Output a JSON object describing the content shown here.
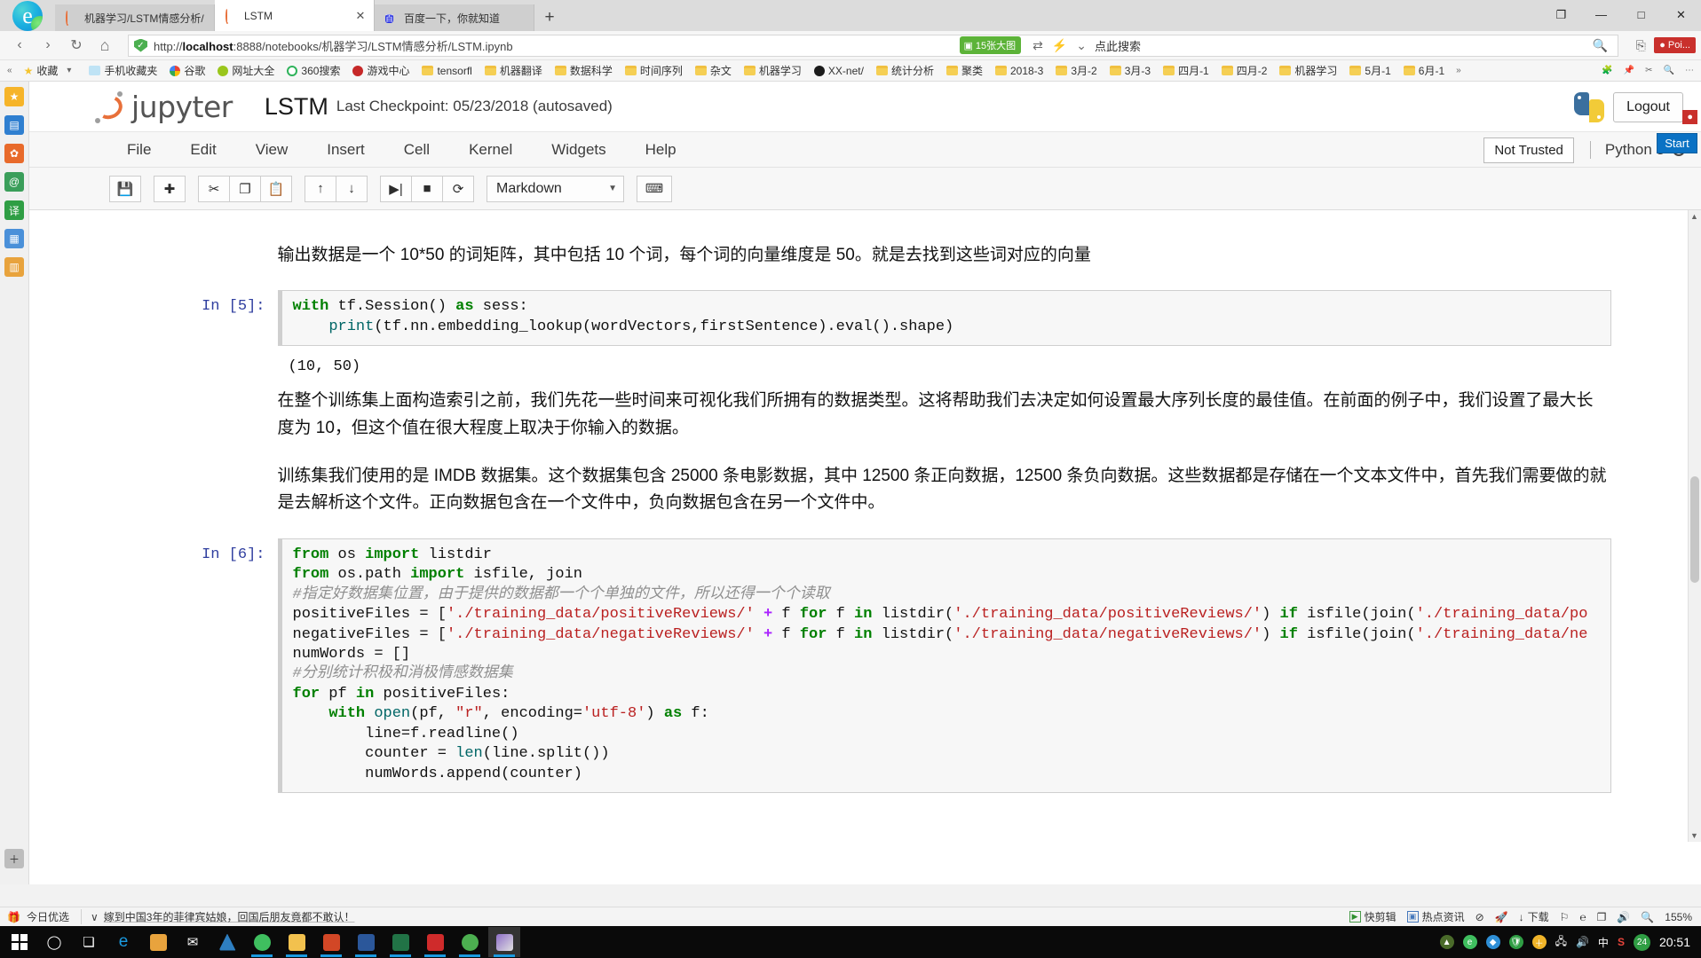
{
  "browser": {
    "tabs": [
      {
        "title": "机器学习/LSTM情感分析/",
        "favicon": "jupyter-icon",
        "active": false,
        "closable": false
      },
      {
        "title": "LSTM",
        "favicon": "jupyter-icon",
        "active": true,
        "closable": true
      },
      {
        "title": "百度一下，你就知道",
        "favicon": "baidu-icon",
        "active": false,
        "closable": false
      }
    ],
    "new_tab_label": "+",
    "window_controls": {
      "restore": "❐",
      "minimize": "—",
      "maximize": "□",
      "close": "✕"
    },
    "url": "http://localhost:8888/notebooks/机器学习/LSTM情感分析/LSTM.ipynb",
    "url_host": "localhost",
    "url_prefix": "http://",
    "url_suffix": ":8888/notebooks/机器学习/LSTM情感分析/LSTM.ipynb",
    "green_badge": "15张大图",
    "search_hint": "点此搜索",
    "poi_label": "Poi...",
    "start_label": "Start",
    "nav": {
      "back": "‹",
      "forward": "›",
      "reload": "↻",
      "home": "⌂"
    },
    "bookmarks": [
      {
        "label": "收藏",
        "icon": "star-icon"
      },
      {
        "label": "手机收藏夹",
        "icon": "phone-icon"
      },
      {
        "label": "谷歌",
        "icon": "chrome-icon"
      },
      {
        "label": "网址大全",
        "icon": "globe-icon"
      },
      {
        "label": "360搜索",
        "icon": "circle-icon"
      },
      {
        "label": "游戏中心",
        "icon": "game-icon"
      },
      {
        "label": "tensorfl",
        "icon": "folder-icon"
      },
      {
        "label": "机器翻译",
        "icon": "folder-icon"
      },
      {
        "label": "数据科学",
        "icon": "folder-icon"
      },
      {
        "label": "时间序列",
        "icon": "folder-icon"
      },
      {
        "label": "杂文",
        "icon": "folder-icon"
      },
      {
        "label": "机器学习",
        "icon": "folder-icon"
      },
      {
        "label": "XX-net/",
        "icon": "github-icon"
      },
      {
        "label": "统计分析",
        "icon": "folder-icon"
      },
      {
        "label": "聚类",
        "icon": "folder-icon"
      },
      {
        "label": "2018-3",
        "icon": "folder-icon"
      },
      {
        "label": "3月-2",
        "icon": "folder-icon"
      },
      {
        "label": "3月-3",
        "icon": "folder-icon"
      },
      {
        "label": "四月-1",
        "icon": "folder-icon"
      },
      {
        "label": "四月-2",
        "icon": "folder-icon"
      },
      {
        "label": "机器学习",
        "icon": "folder-icon"
      },
      {
        "label": "5月-1",
        "icon": "folder-icon"
      },
      {
        "label": "6月-1",
        "icon": "folder-icon"
      }
    ],
    "bookmarks_overflow": "»"
  },
  "jupyter": {
    "brand": "jupyter",
    "notebook_name": "LSTM",
    "checkpoint": "Last Checkpoint: 05/23/2018 (autosaved)",
    "logout_label": "Logout",
    "menu": [
      "File",
      "Edit",
      "View",
      "Insert",
      "Cell",
      "Kernel",
      "Widgets",
      "Help"
    ],
    "trust_status": "Not Trusted",
    "kernel_name": "Python 3",
    "toolbar": {
      "save": "💾",
      "insert_below": "✚",
      "cut": "✂",
      "copy": "❐",
      "paste": "📋",
      "move_up": "↑",
      "move_down": "↓",
      "run": "▶|",
      "stop": "■",
      "restart": "⟳",
      "cell_type": "Markdown",
      "cell_type_arrow": "▼",
      "command_palette": "⌨"
    }
  },
  "notebook": {
    "cells": [
      {
        "type": "markdown",
        "text": "输出数据是一个 10*50 的词矩阵，其中包括 10 个词，每个词的向量维度是 50。就是去找到这些词对应的向量"
      },
      {
        "type": "code",
        "prompt": "In [5]:",
        "lines": [
          "with tf.Session() as sess:",
          "    print(tf.nn.embedding_lookup(wordVectors,firstSentence).eval().shape)"
        ]
      },
      {
        "type": "output",
        "text": "(10, 50)"
      },
      {
        "type": "markdown",
        "text": "在整个训练集上面构造索引之前，我们先花一些时间来可视化我们所拥有的数据类型。这将帮助我们去决定如何设置最大序列长度的最佳值。在前面的例子中，我们设置了最大长度为 10，但这个值在很大程度上取决于你输入的数据。"
      },
      {
        "type": "markdown",
        "text": "训练集我们使用的是 IMDB 数据集。这个数据集包含 25000 条电影数据，其中 12500 条正向数据，12500 条负向数据。这些数据都是存储在一个文本文件中，首先我们需要做的就是去解析这个文件。正向数据包含在一个文件中，负向数据包含在另一个文件中。"
      },
      {
        "type": "code",
        "prompt": "In [6]:",
        "lines": [
          "from os import listdir",
          "from os.path import isfile, join",
          "#指定好数据集位置，由于提供的数据都一个个单独的文件，所以还得一个个读取",
          "positiveFiles = ['./training_data/positiveReviews/' + f for f in listdir('./training_data/positiveReviews/') if isfile(join('./training_data/po",
          "negativeFiles = ['./training_data/negativeReviews/' + f for f in listdir('./training_data/negativeReviews/') if isfile(join('./training_data/ne",
          "numWords = []",
          "#分别统计积极和消极情感数据集",
          "for pf in positiveFiles:",
          "    with open(pf, \"r\", encoding='utf-8') as f:",
          "        line=f.readline()",
          "        counter = len(line.split())",
          "        numWords.append(counter)"
        ]
      }
    ]
  },
  "statusbar": {
    "gift_label": "今日优选",
    "collapse_arrow": "∨",
    "news": "嫁到中国3年的菲律宾姑娘，回国后朋友竟都不敢认！",
    "right_items": [
      {
        "label": "快剪辑",
        "icon": "scissors-icon"
      },
      {
        "label": "热点资讯",
        "icon": "news-icon"
      },
      {
        "label": "",
        "icon": "speed-icon"
      },
      {
        "label": "",
        "icon": "rocket-icon"
      },
      {
        "label": "下载",
        "icon": "download-icon"
      },
      {
        "label": "",
        "icon": "flag-icon"
      },
      {
        "label": "",
        "icon": "edge-icon"
      },
      {
        "label": "",
        "icon": "window-icon"
      },
      {
        "label": "",
        "icon": "volume-icon"
      },
      {
        "label": "",
        "icon": "search-icon"
      }
    ],
    "zoom": "155%"
  },
  "taskbar": {
    "start_icon": "windows-icon",
    "apps": [
      {
        "icon": "cortana-icon",
        "color": "#ffffff",
        "active": false
      },
      {
        "icon": "taskview-icon",
        "color": "#ffffff",
        "active": false
      },
      {
        "icon": "ie-icon",
        "color": "#1a9ae0",
        "active": false
      },
      {
        "icon": "store-icon",
        "color": "#e8a33d",
        "active": false
      },
      {
        "icon": "mail-icon",
        "color": "#ffffff",
        "active": false
      },
      {
        "icon": "foxmail-icon",
        "color": "#2e7fc1",
        "active": false
      },
      {
        "icon": "edge-icon",
        "color": "#3fbf5f",
        "active": true
      },
      {
        "icon": "explorer-icon",
        "color": "#f2c14e",
        "active": true
      },
      {
        "icon": "powerpoint-icon",
        "color": "#d24726",
        "active": true
      },
      {
        "icon": "word-icon",
        "color": "#2b579a",
        "active": true
      },
      {
        "icon": "excel-icon",
        "color": "#217346",
        "active": true
      },
      {
        "icon": "pdf-icon",
        "color": "#cf2b2b",
        "active": true
      },
      {
        "icon": "wechat-icon",
        "color": "#4caf50",
        "active": true
      },
      {
        "icon": "paint-icon",
        "color": "#8e6ec8",
        "active": true
      }
    ],
    "tray": [
      {
        "icon": "nvidia-icon",
        "color": "#4a6b2a"
      },
      {
        "icon": "edge-tray-icon",
        "color": "#3fbf5f"
      },
      {
        "icon": "box-icon",
        "color": "#2e8fd6"
      },
      {
        "icon": "shield-icon",
        "color": "#2f9e44"
      },
      {
        "icon": "plus-icon",
        "color": "#f0b429"
      },
      {
        "icon": "network-icon",
        "color": "#dddddd"
      },
      {
        "icon": "volume-icon",
        "color": "#dddddd"
      },
      {
        "icon": "ime-icon",
        "color": "#ffffff",
        "label": "中"
      },
      {
        "icon": "sogou-icon",
        "color": "#e8453c",
        "label": "S"
      },
      {
        "icon": "badge-24-icon",
        "color": "#2f9e44",
        "label": "24"
      }
    ],
    "clock": "20:51"
  }
}
